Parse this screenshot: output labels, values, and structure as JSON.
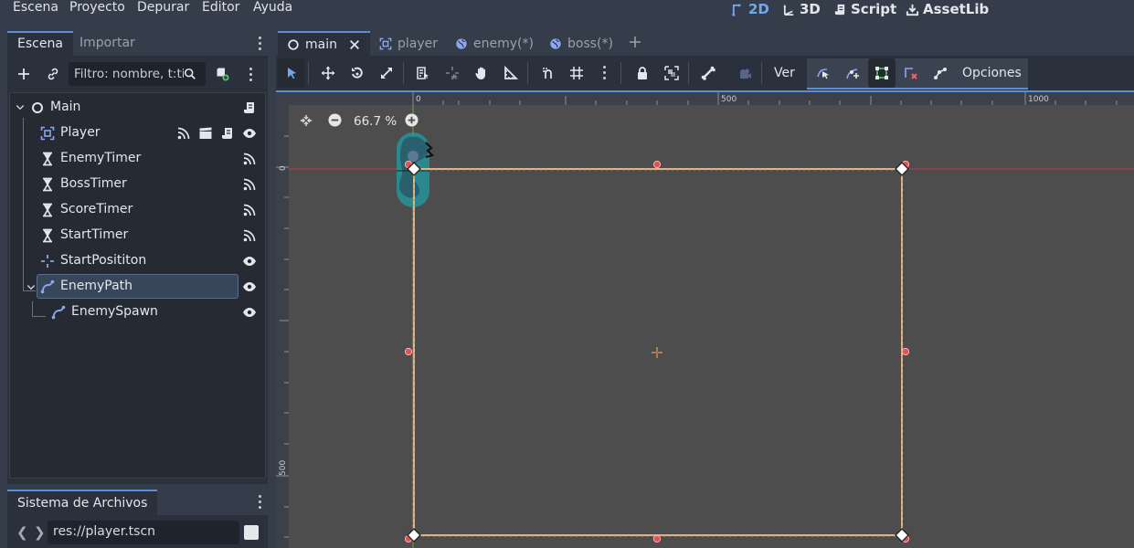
{
  "menu": {
    "items": [
      "Escena",
      "Proyecto",
      "Depurar",
      "Editor",
      "Ayuda"
    ]
  },
  "workspaces": [
    {
      "label": "2D",
      "icon": "2d-icon",
      "active": true
    },
    {
      "label": "3D",
      "icon": "3d-icon",
      "active": false
    },
    {
      "label": "Script",
      "icon": "script-icon",
      "active": false
    },
    {
      "label": "AssetLib",
      "icon": "assetlib-icon",
      "active": false
    }
  ],
  "scene_dock": {
    "tabs": [
      "Escena",
      "Importar"
    ],
    "filter_placeholder": "Filtro: nombre, t:ti",
    "tree": [
      {
        "label": "Main",
        "icon": "node2d-icon",
        "depth": 0
      },
      {
        "label": "Player",
        "icon": "area2d-icon",
        "depth": 1
      },
      {
        "label": "EnemyTimer",
        "icon": "timer-icon",
        "depth": 1
      },
      {
        "label": "BossTimer",
        "icon": "timer-icon",
        "depth": 1
      },
      {
        "label": "ScoreTimer",
        "icon": "timer-icon",
        "depth": 1
      },
      {
        "label": "StartTimer",
        "icon": "timer-icon",
        "depth": 1
      },
      {
        "label": "StartPosititon",
        "icon": "marker2d-icon",
        "depth": 1
      },
      {
        "label": "EnemyPath",
        "icon": "path2d-icon",
        "depth": 1,
        "selected": true
      },
      {
        "label": "EnemySpawn",
        "icon": "pathfollow-icon",
        "depth": 2
      }
    ]
  },
  "filesystem": {
    "tab": "Sistema de Archivos",
    "path": "res://player.tscn"
  },
  "editor_tabs": [
    {
      "label": "main",
      "icon": "node2d-icon",
      "active": true
    },
    {
      "label": "player",
      "icon": "area2d-icon",
      "active": false
    },
    {
      "label": "enemy(*)",
      "icon": "globe-icon",
      "active": false
    },
    {
      "label": "boss(*)",
      "icon": "globe-icon",
      "active": false
    }
  ],
  "toolbar": {
    "view_label": "Ver",
    "options_label": "Opciones"
  },
  "viewport": {
    "zoom": "66.7 %",
    "ruler_x": [
      "0",
      "500",
      "1000"
    ],
    "ruler_y": [
      "0",
      "500"
    ]
  },
  "colors": {
    "accent": "#5a8fd8",
    "viewport_bg": "#4d4d4d",
    "path": "#e8b08c"
  }
}
